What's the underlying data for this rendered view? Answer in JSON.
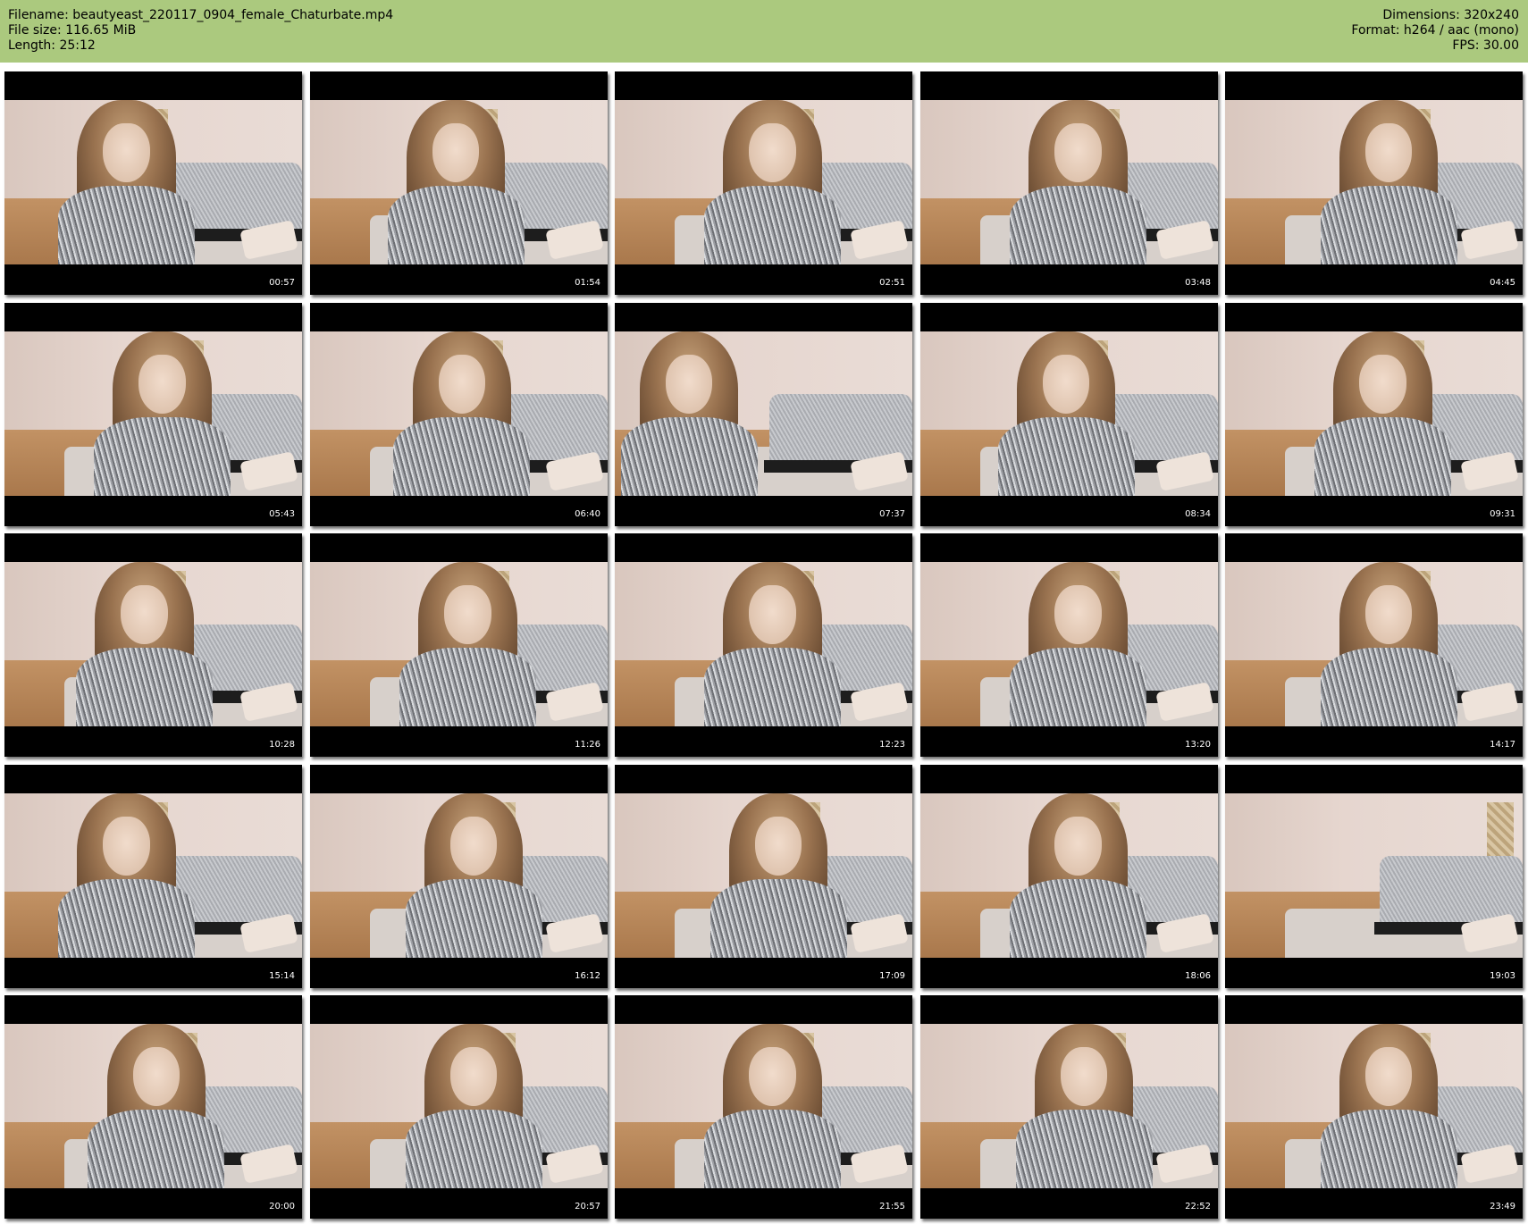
{
  "header": {
    "filename": "Filename: beautyeast_220117_0904_female_Chaturbate.mp4",
    "filesize": "File size: 116.65 MiB",
    "length": "Length: 25:12",
    "dimensions": "Dimensions: 320x240",
    "format": "Format: h264 / aac (mono)",
    "fps": "FPS: 30.00"
  },
  "thumbnails": [
    {
      "time": "00:57"
    },
    {
      "time": "01:54"
    },
    {
      "time": "02:51"
    },
    {
      "time": "03:48"
    },
    {
      "time": "04:45"
    },
    {
      "time": "05:43"
    },
    {
      "time": "06:40"
    },
    {
      "time": "07:37"
    },
    {
      "time": "08:34"
    },
    {
      "time": "09:31"
    },
    {
      "time": "10:28"
    },
    {
      "time": "11:26"
    },
    {
      "time": "12:23"
    },
    {
      "time": "13:20"
    },
    {
      "time": "14:17"
    },
    {
      "time": "15:14"
    },
    {
      "time": "16:12"
    },
    {
      "time": "17:09"
    },
    {
      "time": "18:06"
    },
    {
      "time": "19:03"
    },
    {
      "time": "20:00"
    },
    {
      "time": "20:57"
    },
    {
      "time": "21:55"
    },
    {
      "time": "22:52"
    },
    {
      "time": "23:49"
    }
  ],
  "colors": {
    "header_bg": "#abc97e",
    "thumb_bg": "#000000",
    "timestamp": "#ffffff"
  }
}
